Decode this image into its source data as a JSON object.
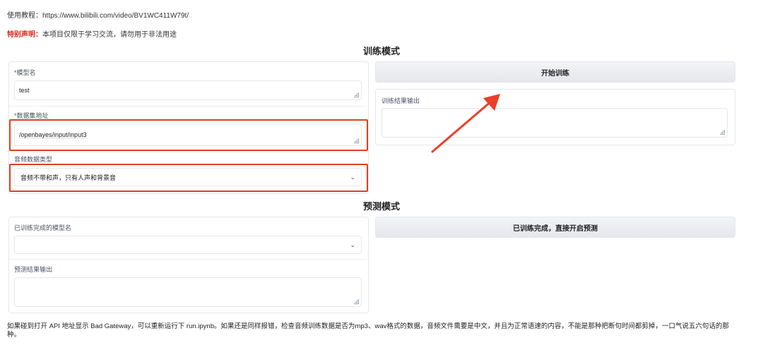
{
  "header": {
    "tutorial_label": "使用教程：",
    "tutorial_url": "https://www.bilibili.com/video/BV1WC411W79t/",
    "notice_key": "特别声明：",
    "notice_text": "本项目仅限于学习交流，请勿用于非法用途"
  },
  "train": {
    "title": "训练模式",
    "model_name_label": "*模型名",
    "model_name_value": "test",
    "dataset_path_label": "*数据集地址",
    "dataset_path_value": "/openbayes/input/input3",
    "audio_type_label": "音频数据类型",
    "audio_type_value": "音频不带和声，只有人声和背景音",
    "start_button": "开始训练",
    "output_label": "训练结果输出",
    "output_value": ""
  },
  "predict": {
    "title": "预测模式",
    "trained_model_label": "已训练完成的模型名",
    "trained_model_value": "",
    "output_label": "预测结果输出",
    "output_value": "",
    "predict_button": "已训练完成，直接开启预测"
  },
  "footer": {
    "note": "如果碰到打开 API 地址显示 Bad Gateway，可以重新运行下 run.ipynb。如果还是同样报错，检查音频训练数据是否为mp3、wav格式的数据，音频文件需要是中文，并且为正常语速的内容，不能是那种把断句时间都剪掉，一口气说五六句话的那种。"
  },
  "colors": {
    "highlight": "#e0401f",
    "arrow": "#e8402a",
    "notice": "#e0241b"
  },
  "icons": {
    "dropdown": "chevron-down-icon",
    "resize": "resize-grip-icon"
  }
}
